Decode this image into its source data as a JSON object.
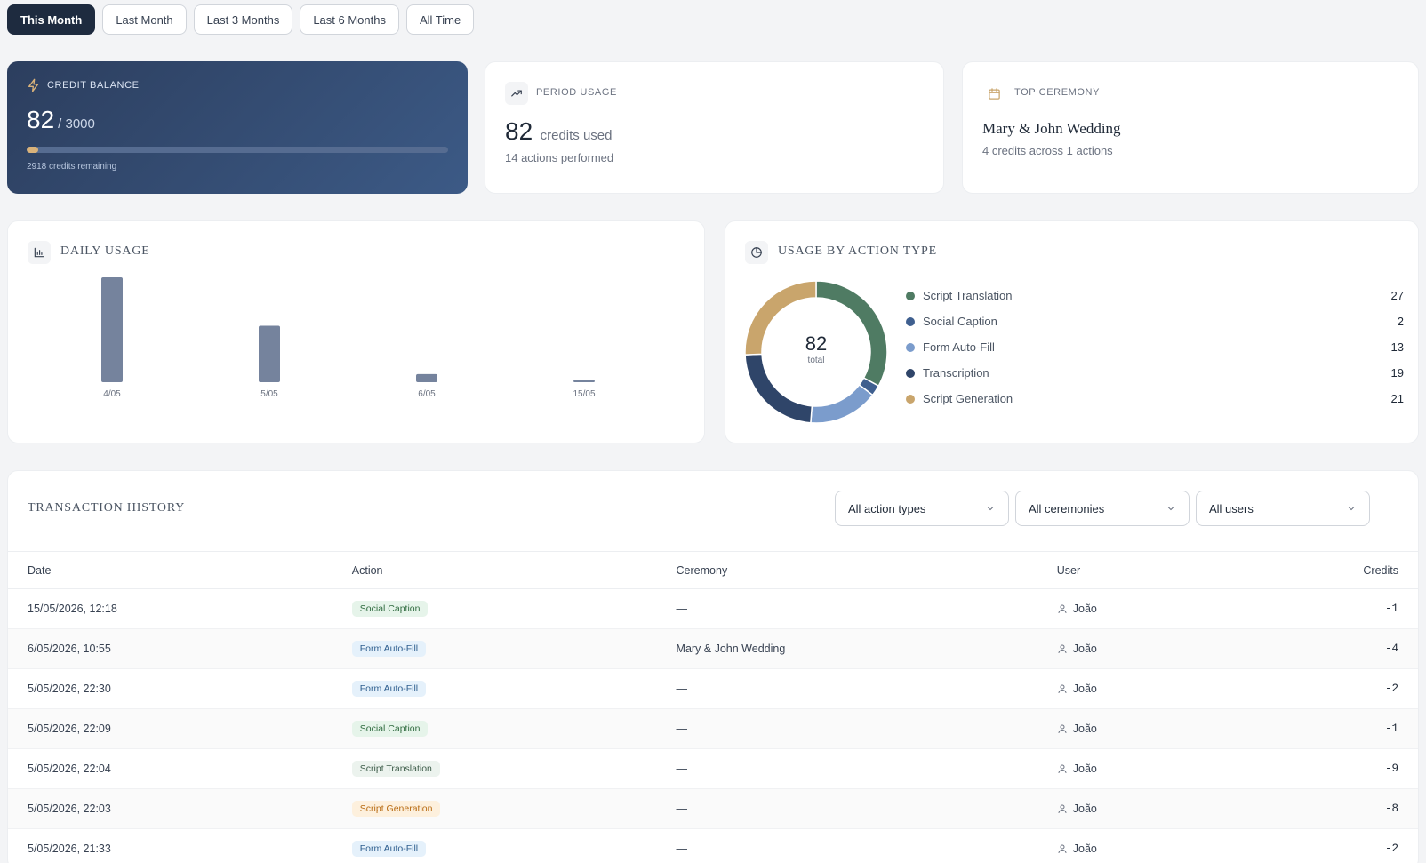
{
  "tabs": [
    {
      "label": "This Month",
      "active": true
    },
    {
      "label": "Last Month",
      "active": false
    },
    {
      "label": "Last 3 Months",
      "active": false
    },
    {
      "label": "Last 6 Months",
      "active": false
    },
    {
      "label": "All Time",
      "active": false
    }
  ],
  "balance": {
    "caption": "CREDIT BALANCE",
    "value": "82",
    "of": "/ 3000",
    "progress_fraction": 0.027,
    "remaining": "2918 credits remaining"
  },
  "usage": {
    "caption": "PERIOD USAGE",
    "value": "82",
    "unit": "credits used",
    "sub": "14 actions performed"
  },
  "top_ceremony": {
    "caption": "TOP CEREMONY",
    "name": "Mary & John Wedding",
    "sub": "4 credits across 1 actions"
  },
  "daily_usage": {
    "title": "DAILY USAGE"
  },
  "by_type": {
    "title": "USAGE BY ACTION TYPE",
    "total": "82",
    "total_label": "total"
  },
  "chart_data": [
    {
      "type": "bar",
      "title": "DAILY USAGE",
      "categories": [
        "4/05",
        "5/05",
        "6/05",
        "15/05"
      ],
      "values": [
        52,
        28,
        4,
        1
      ],
      "ylim": [
        0,
        52
      ],
      "grid": false
    },
    {
      "type": "pie",
      "title": "USAGE BY ACTION TYPE",
      "categories": [
        "Script Translation",
        "Social Caption",
        "Form Auto-Fill",
        "Transcription",
        "Script Generation"
      ],
      "values": [
        27,
        2,
        13,
        19,
        21
      ],
      "colors": [
        "#4f7b63",
        "#3f5f8f",
        "#7b9ccc",
        "#2f4569",
        "#c9a56c"
      ],
      "donut": true,
      "legend": "right"
    }
  ],
  "history": {
    "title": "TRANSACTION HISTORY",
    "filters": [
      "All action types",
      "All ceremonies",
      "All users"
    ],
    "columns": [
      "Date",
      "Action",
      "Ceremony",
      "User",
      "Credits"
    ],
    "rows": [
      {
        "date": "15/05/2026, 12:18",
        "action": "Social Caption",
        "ceremony": "—",
        "user": "João",
        "credits": "-1"
      },
      {
        "date": "6/05/2026, 10:55",
        "action": "Form Auto-Fill",
        "ceremony": "Mary & John Wedding",
        "user": "João",
        "credits": "-4"
      },
      {
        "date": "5/05/2026, 22:30",
        "action": "Form Auto-Fill",
        "ceremony": "—",
        "user": "João",
        "credits": "-2"
      },
      {
        "date": "5/05/2026, 22:09",
        "action": "Social Caption",
        "ceremony": "—",
        "user": "João",
        "credits": "-1"
      },
      {
        "date": "5/05/2026, 22:04",
        "action": "Script Translation",
        "ceremony": "—",
        "user": "João",
        "credits": "-9"
      },
      {
        "date": "5/05/2026, 22:03",
        "action": "Script Generation",
        "ceremony": "—",
        "user": "João",
        "credits": "-8"
      },
      {
        "date": "5/05/2026, 21:33",
        "action": "Form Auto-Fill",
        "ceremony": "—",
        "user": "João",
        "credits": "-2"
      }
    ]
  },
  "badge_colors": {
    "Social Caption": {
      "bg": "#e6f4ea",
      "fg": "#2f6b3f"
    },
    "Form Auto-Fill": {
      "bg": "#e5f1fb",
      "fg": "#2f5f8f"
    },
    "Script Translation": {
      "bg": "#ecf3ee",
      "fg": "#3e5d4a"
    },
    "Script Generation": {
      "bg": "#fdf0dd",
      "fg": "#b86b12"
    }
  }
}
